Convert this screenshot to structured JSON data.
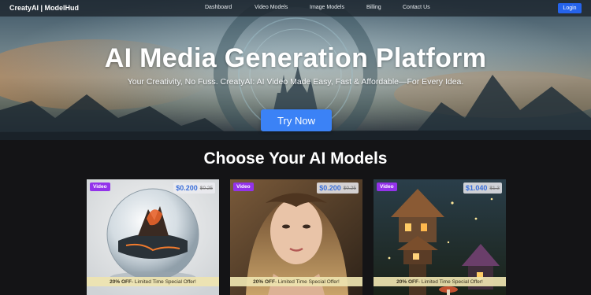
{
  "navbar": {
    "brand": "CreatyAI | ModelHud",
    "links": [
      "Dashboard",
      "Video Models",
      "Image Models",
      "Billing",
      "Contact Us"
    ],
    "login_label": "Login"
  },
  "hero": {
    "title": "AI Media Generation Platform",
    "subtitle": "Your Creativity, No Fuss. CreatyAI: AI Video Made Easy, Fast & Affordable—For Every Idea.",
    "cta_label": "Try Now"
  },
  "models": {
    "title": "Choose Your AI Models",
    "cards": [
      {
        "badge": "Video",
        "price": "$0.200",
        "old_price": "$0.25",
        "offer_strong": "20% OFF",
        "offer_rest": " - Limited Time Special Offer!",
        "image": "crystal-sphere-volcano"
      },
      {
        "badge": "Video",
        "price": "$0.200",
        "old_price": "$0.25",
        "offer_strong": "20% OFF",
        "offer_rest": " - Limited Time Special Offer!",
        "image": "woman-portrait"
      },
      {
        "badge": "Video",
        "price": "$1.040",
        "old_price": "$1.3",
        "offer_strong": "20% OFF",
        "offer_rest": " - Limited Time Special Offer!",
        "image": "fantasy-treehouse-night"
      }
    ]
  },
  "colors": {
    "accent_blue": "#3b82f6",
    "login_blue": "#2563eb",
    "badge_purple": "#9333ea",
    "price_blue": "#3b6fd9",
    "page_bg": "#141416"
  }
}
